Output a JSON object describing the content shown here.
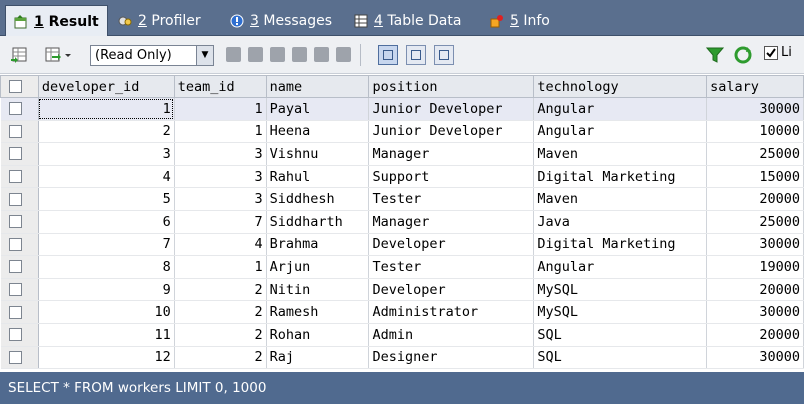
{
  "tabs": [
    {
      "num": "1",
      "label": "Result",
      "active": true,
      "icon": "result-grid-icon"
    },
    {
      "num": "2",
      "label": "Profiler",
      "active": false,
      "icon": "profiler-icon"
    },
    {
      "num": "3",
      "label": "Messages",
      "active": false,
      "icon": "messages-icon"
    },
    {
      "num": "4",
      "label": "Table Data",
      "active": false,
      "icon": "table-data-icon"
    },
    {
      "num": "5",
      "label": "Info",
      "active": false,
      "icon": "info-icon"
    }
  ],
  "toolbar": {
    "mode_select": "(Read Only)",
    "filter_checkbox_label": "Li"
  },
  "grid": {
    "columns": [
      "developer_id",
      "team_id",
      "name",
      "position",
      "technology",
      "salary"
    ],
    "rows": [
      [
        "1",
        "1",
        "Payal",
        "Junior Developer",
        "Angular",
        "30000"
      ],
      [
        "2",
        "1",
        "Heena",
        "Junior Developer",
        "Angular",
        "10000"
      ],
      [
        "3",
        "3",
        "Vishnu",
        "Manager",
        "Maven",
        "25000"
      ],
      [
        "4",
        "3",
        "Rahul",
        "Support",
        "Digital Marketing",
        "15000"
      ],
      [
        "5",
        "3",
        "Siddhesh",
        "Tester",
        "Maven",
        "20000"
      ],
      [
        "6",
        "7",
        "Siddharth",
        "Manager",
        "Java",
        "25000"
      ],
      [
        "7",
        "4",
        "Brahma",
        "Developer",
        "Digital Marketing",
        "30000"
      ],
      [
        "8",
        "1",
        "Arjun",
        "Tester",
        "Angular",
        "19000"
      ],
      [
        "9",
        "2",
        "Nitin",
        "Developer",
        "MySQL",
        "20000"
      ],
      [
        "10",
        "2",
        "Ramesh",
        "Administrator",
        "MySQL",
        "30000"
      ],
      [
        "11",
        "2",
        "Rohan",
        "Admin",
        "SQL",
        "20000"
      ],
      [
        "12",
        "2",
        "Raj",
        "Designer",
        "SQL",
        "30000"
      ]
    ]
  },
  "status": {
    "query": "SELECT * FROM workers LIMIT 0, 1000"
  },
  "colors": {
    "tabbar": "#5a6f8e",
    "statusbar": "#506a8f",
    "filter_funnel": "#2e9b2e",
    "refresh": "#2e9b2e"
  }
}
